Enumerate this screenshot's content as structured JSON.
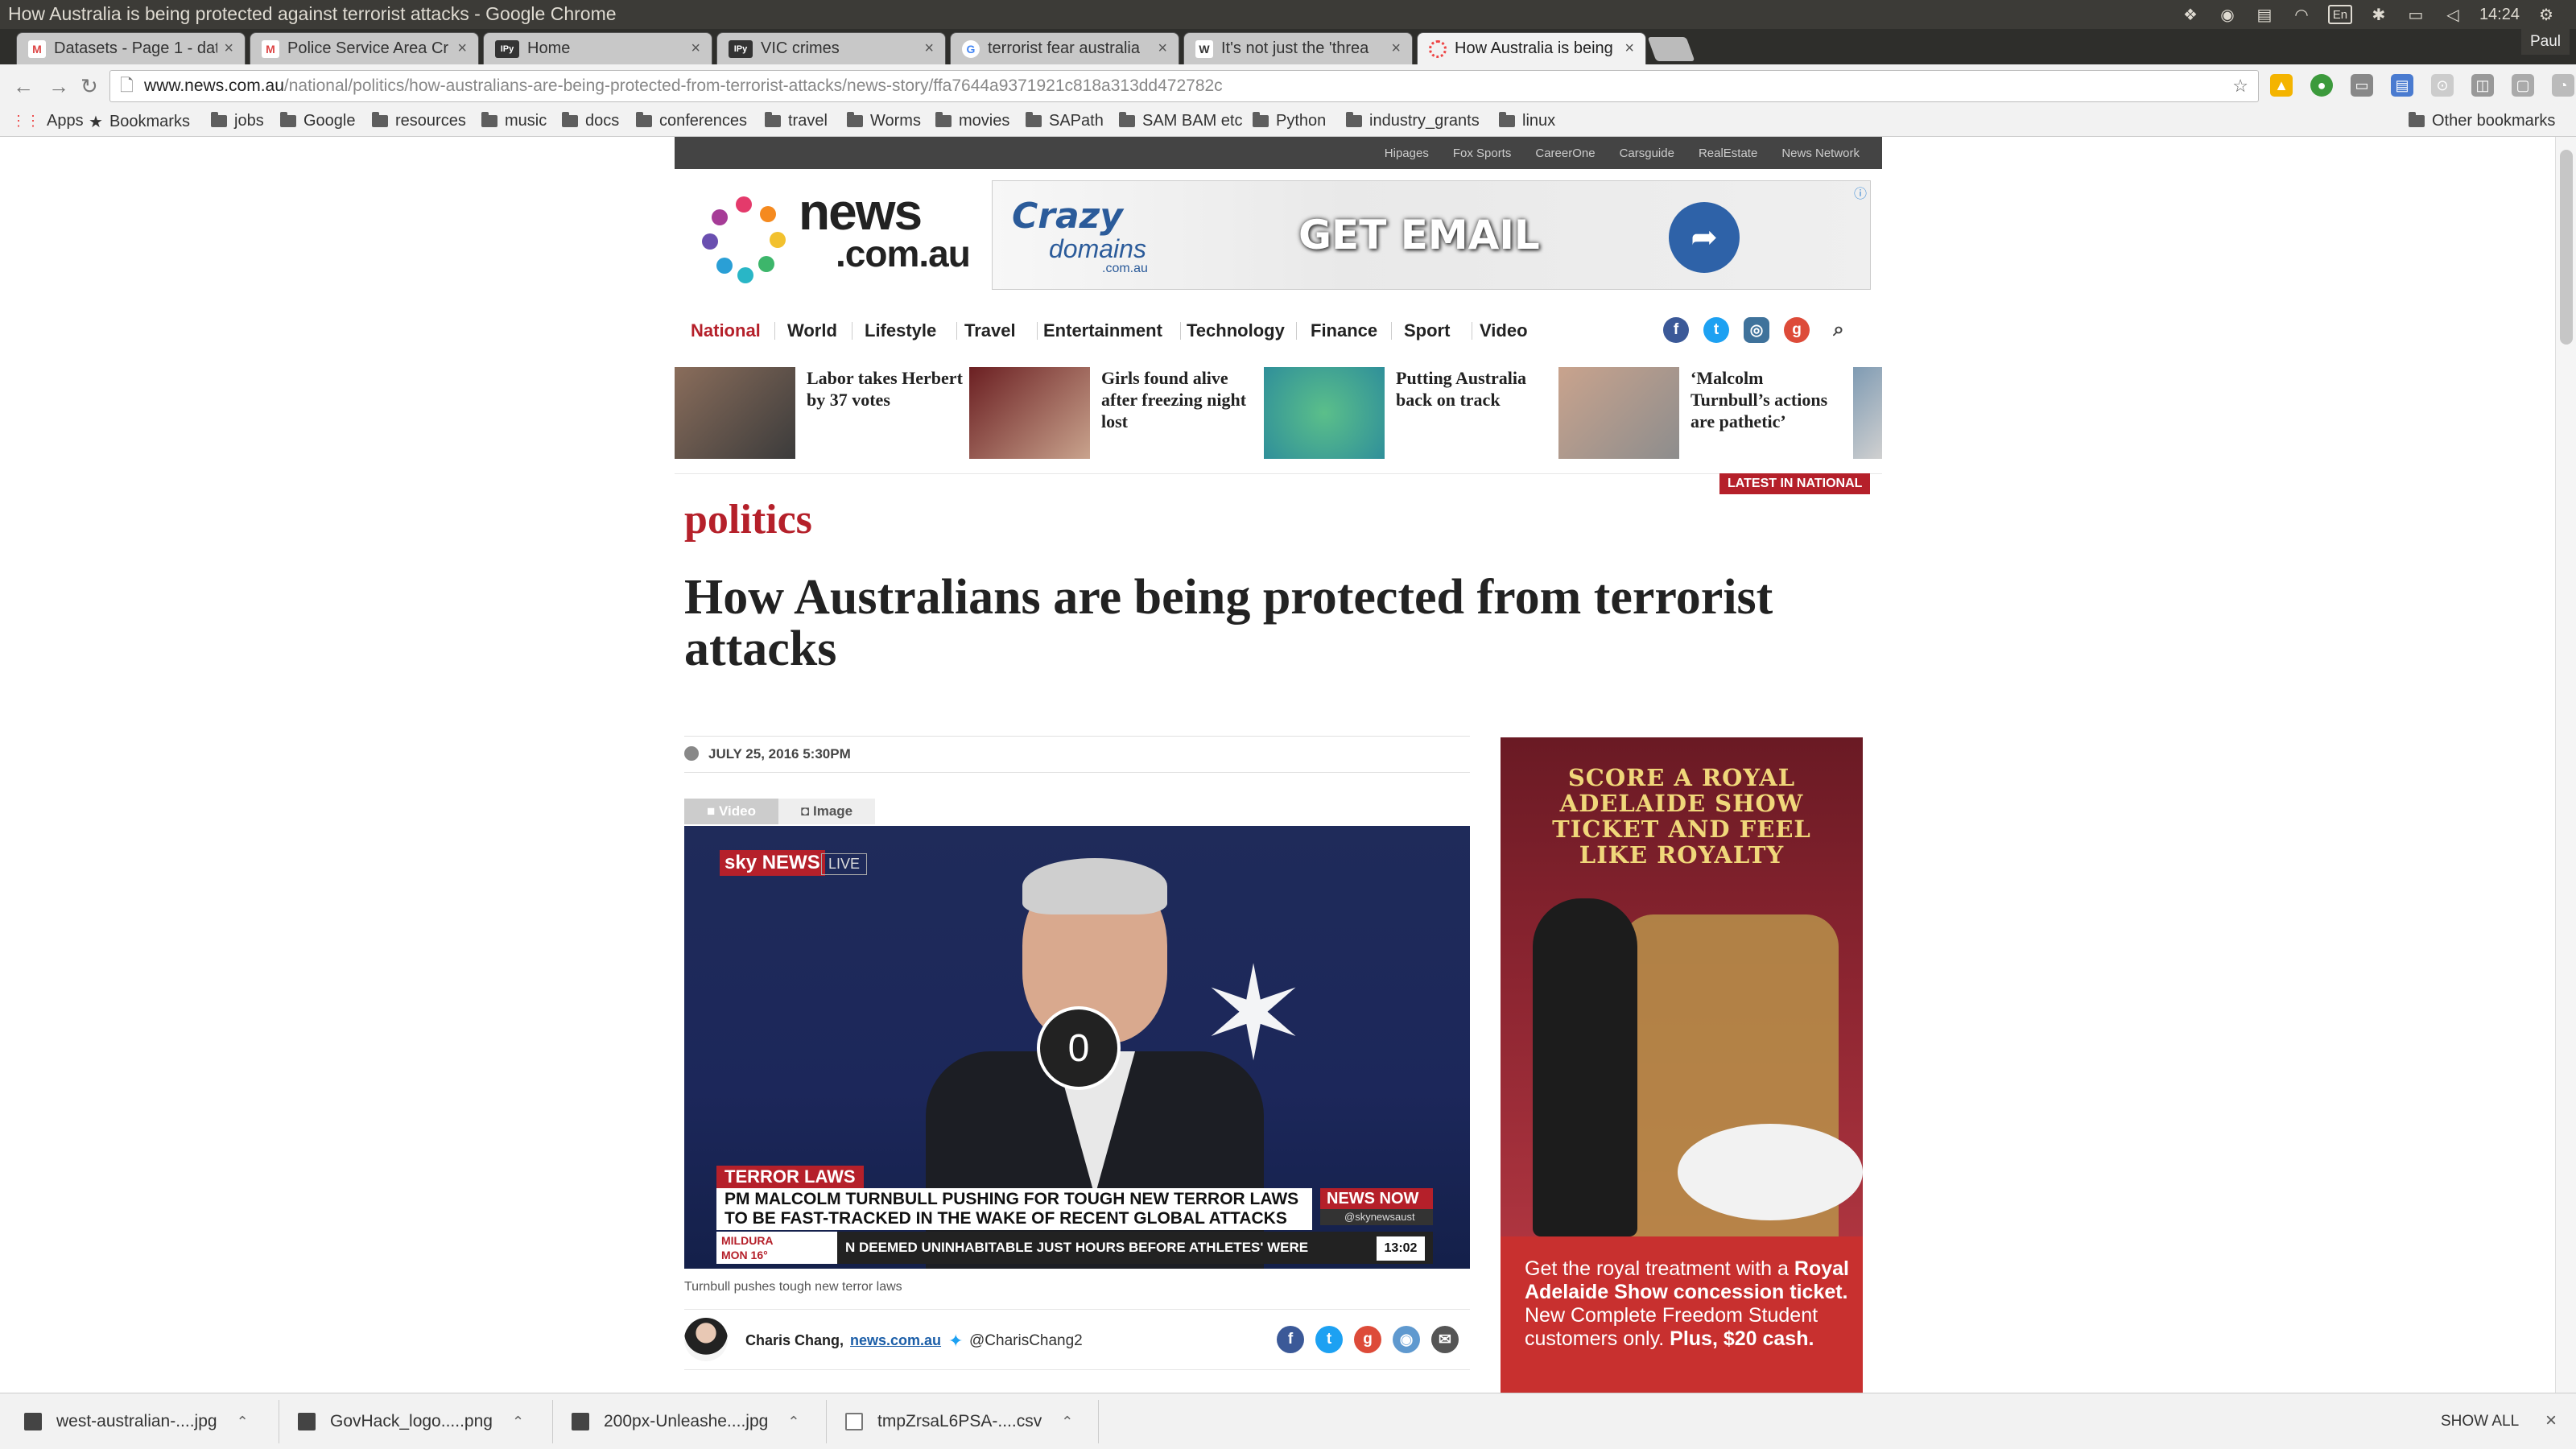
{
  "os": {
    "window_title": "How Australia is being protected against terrorist attacks - Google Chrome",
    "lang": "En",
    "clock": "14:24"
  },
  "user": "Paul",
  "tabs": [
    {
      "label": "Datasets - Page 1 - dat",
      "favicon": "gmail-icon",
      "active": false
    },
    {
      "label": "Police Service Area Cr",
      "favicon": "gmail-icon",
      "active": false
    },
    {
      "label": "Home",
      "favicon": "ipython-icon",
      "active": false
    },
    {
      "label": "VIC crimes",
      "favicon": "ipython-icon",
      "active": false
    },
    {
      "label": "terrorist fear australia",
      "favicon": "google-icon",
      "active": false
    },
    {
      "label": "It's not just the 'threa",
      "favicon": "news-icon",
      "active": false
    },
    {
      "label": "How Australia is being",
      "favicon": "loading-icon",
      "active": true
    }
  ],
  "fav_text": {
    "ipy": "IPy",
    "google": "G",
    "news": "W",
    "gmail": "M"
  },
  "omnibox": {
    "host": "www.news.com.au",
    "path": "/national/politics/how-australians-are-being-protected-from-terrorist-attacks/news-story/ffa7644a9371921c818a313dd472782c"
  },
  "bookmarks": {
    "apps": "Apps",
    "bookmarks": "Bookmarks",
    "folders": [
      "jobs",
      "Google",
      "resources",
      "music",
      "docs",
      "conferences",
      "travel",
      "Worms",
      "movies",
      "SAPath",
      "SAM BAM etc",
      "Python",
      "industry_grants",
      "linux"
    ],
    "other": "Other bookmarks"
  },
  "site": {
    "top_links": [
      "Hipages",
      "Fox Sports",
      "CareerOne",
      "Carsguide",
      "RealEstate",
      "News Network"
    ],
    "logo_main": "news",
    "logo_sub": ".com.au",
    "nav": [
      "National",
      "World",
      "Lifestyle",
      "Travel",
      "Entertainment",
      "Technology",
      "Finance",
      "Sport",
      "Video"
    ],
    "latest": [
      "Labor takes Herbert by 37 votes",
      "Girls found alive after freezing night lost",
      "Putting Australia back on track",
      "‘Malcolm Turnbull’s actions are pathetic’"
    ],
    "latest_tag": "LATEST IN NATIONAL"
  },
  "ad_banner": {
    "brand_top": "Crazy",
    "brand_bottom": "domains",
    "brand_sub": ".com.au",
    "headline": "GET EMAIL"
  },
  "article": {
    "section": "politics",
    "headline": "How Australians are being protected from terrorist attacks",
    "date": "JULY 25, 2016",
    "time": "5:30PM",
    "media_tabs": [
      "Video",
      "Image"
    ],
    "video": {
      "overlay_count": "0",
      "sky_logo": "sky NEWS",
      "live": "LIVE",
      "ticker_tag": "TERROR LAWS",
      "ticker_main": "PM MALCOLM TURNBULL PUSHING FOR TOUGH NEW TERROR LAWS TO BE FAST-TRACKED IN THE WAKE OF RECENT GLOBAL ATTACKS",
      "news_now": "NEWS NOW",
      "handle": "@skynewsaust",
      "weather_city": "MILDURA",
      "weather": "MON 16°",
      "crawl": "N DEEMED UNINHABITABLE JUST HOURS BEFORE ATHLETES' WERE",
      "clock": "13:02"
    },
    "caption": "Turnbull pushes tough new terror laws",
    "author": "Charis Chang,",
    "author_site": "news.com.au",
    "twitter": "@CharisChang2"
  },
  "side_ad": {
    "heading": "SCORE A ROYAL ADELAIDE SHOW TICKET AND FEEL LIKE ROYALTY",
    "line1": "Get the royal treatment with a ",
    "bold1": "Royal Adelaide Show concession ticket.",
    "line2": " New Complete Freedom Student customers only. ",
    "bold2": "Plus, $20 cash."
  },
  "downloads": {
    "items": [
      "west-australian-....jpg",
      "GovHack_logo.....png",
      "200px-Unleashe....jpg",
      "tmpZrsaL6PSA-....csv"
    ],
    "show_all": "SHOW ALL"
  },
  "colors": {
    "brand_red": "#b5202a",
    "facebook": "#3b5998",
    "twitter": "#1da1f2",
    "instagram": "#3f729b",
    "gplus": "#dd4b39"
  }
}
